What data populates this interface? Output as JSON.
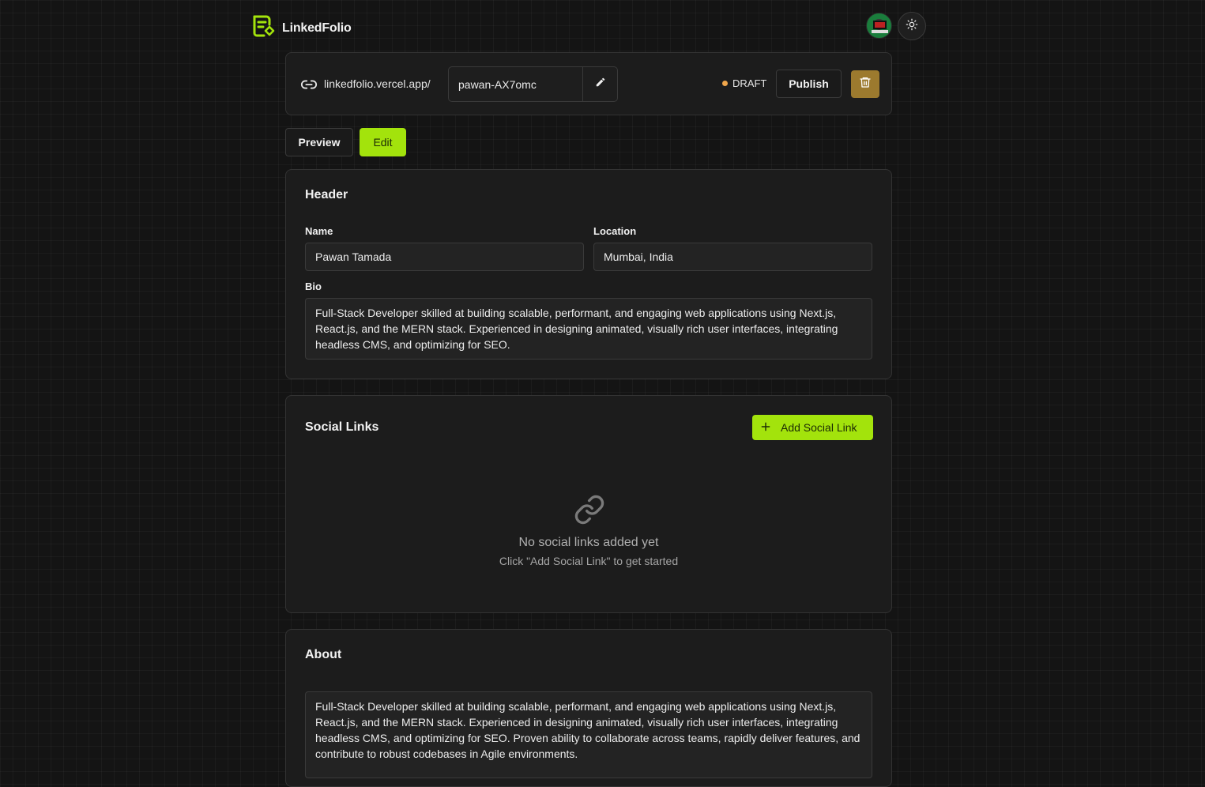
{
  "app": {
    "name": "LinkedFolio"
  },
  "colors": {
    "accent": "#a3e30c",
    "draft": "#f0a64b",
    "delete": "#9c7a2e",
    "background": "#141414",
    "card": "#1c1c1c"
  },
  "url": {
    "prefix": "linkedfolio.vercel.app/",
    "slug": "pawan-AX7omc",
    "status": "DRAFT",
    "publish_label": "Publish"
  },
  "tabs": {
    "preview": "Preview",
    "edit": "Edit"
  },
  "header_section": {
    "title": "Header",
    "name_label": "Name",
    "name_value": "Pawan Tamada",
    "location_label": "Location",
    "location_value": "Mumbai, India",
    "bio_label": "Bio",
    "bio_value": "Full-Stack Developer skilled at building scalable, performant, and engaging web applications using Next.js, React.js, and the MERN stack. Experienced in designing animated, visually rich user interfaces, integrating headless CMS, and optimizing for SEO."
  },
  "social_section": {
    "title": "Social Links",
    "add_label": "Add Social Link",
    "empty_title": "No social links added yet",
    "empty_sub": "Click \"Add Social Link\" to get started"
  },
  "about_section": {
    "title": "About",
    "text": "Full-Stack Developer skilled at building scalable, performant, and engaging web applications using Next.js, React.js, and the MERN stack. Experienced in designing animated, visually rich user interfaces, integrating headless CMS, and optimizing for SEO. Proven ability to collaborate across teams, rapidly deliver features, and contribute to robust codebases in Agile environments."
  }
}
